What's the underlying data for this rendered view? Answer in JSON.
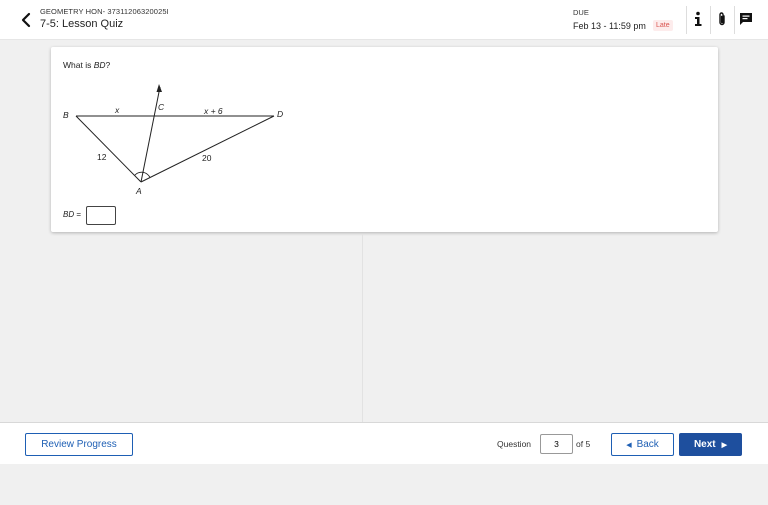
{
  "header": {
    "course": "GEOMETRY HON- 37311206320025I",
    "quiz_title": "7-5: Lesson Quiz",
    "due_label": "DUE",
    "due_date": "Feb 13 - 11:59 pm",
    "late_badge": "Late",
    "icons": [
      "back-chevron-icon",
      "info-icon",
      "paperclip-icon",
      "comment-icon"
    ]
  },
  "question": {
    "prompt_prefix": "What is ",
    "prompt_var": "BD",
    "prompt_suffix": "?",
    "figure": {
      "labels": {
        "B": "B",
        "C": "C",
        "D": "D",
        "A": "A",
        "BC": "x",
        "CD": "x + 6",
        "BA": "12",
        "AD": "20"
      }
    },
    "answer_var": "BD",
    "answer_eq": " =",
    "answer_value": ""
  },
  "footer": {
    "review_label": "Review Progress",
    "question_label": "Question",
    "question_number": "3",
    "of_label": "of 5",
    "back_label": "Back",
    "next_label": "Next"
  },
  "colors": {
    "accent": "#1e5fb4",
    "next_bg": "#1e4f9e",
    "late": "#d9534f",
    "page_bg": "#f0f0f0"
  }
}
